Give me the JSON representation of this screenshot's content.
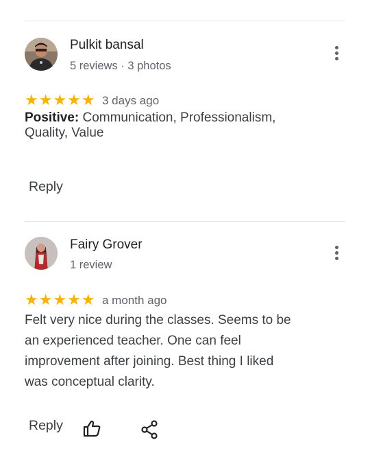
{
  "reviews": [
    {
      "author": "Pulkit bansal",
      "meta": "5 reviews · 3 photos",
      "stars": "★★★★★",
      "rating": 5,
      "time": "3 days ago",
      "positive_label": "Positive:",
      "positive_line1": " Communication, Professionalism,",
      "positive_line2": " Quality, Value",
      "reply_label": "Reply"
    },
    {
      "author": "Fairy Grover",
      "meta": "1 review",
      "stars": "★★★★★",
      "rating": 5,
      "time": "a month ago",
      "text_lines": [
        "Felt very nice during the classes. Seems to be",
        "an experienced teacher. One can feel",
        "improvement after joining. Best thing I liked",
        "was conceptual clarity."
      ],
      "reply_label": "Reply"
    }
  ],
  "colors": {
    "star": "#f4b400",
    "text": "#3c4043",
    "secondary": "#5f6368"
  }
}
